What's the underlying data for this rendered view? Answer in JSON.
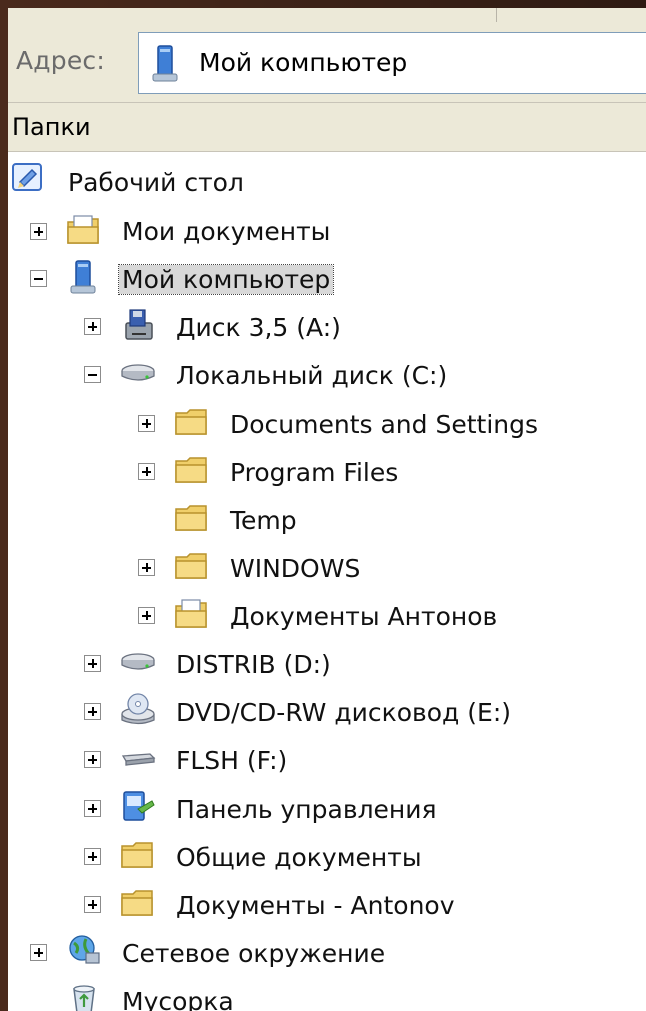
{
  "address": {
    "label": "Адрес:",
    "value": "Мой компьютер",
    "icon": "my-computer-icon"
  },
  "folders_pane": {
    "header": "Папки"
  },
  "tree": [
    {
      "label": "Рабочий стол",
      "icon": "desktop-icon",
      "expanded": true
    },
    {
      "label": "Мои документы",
      "icon": "my-documents-icon",
      "expanded": false
    },
    {
      "label": "Мой компьютер",
      "icon": "my-computer-icon",
      "expanded": true,
      "selected": true
    },
    {
      "label": "Диск 3,5 (A:)",
      "icon": "floppy-drive-icon",
      "expanded": false
    },
    {
      "label": "Локальный диск (C:)",
      "icon": "hard-drive-icon",
      "expanded": true
    },
    {
      "label": "Documents and Settings",
      "icon": "folder-icon",
      "expanded": false
    },
    {
      "label": "Program Files",
      "icon": "folder-icon",
      "expanded": false
    },
    {
      "label": "Temp",
      "icon": "folder-icon"
    },
    {
      "label": "WINDOWS",
      "icon": "folder-icon",
      "expanded": false
    },
    {
      "label": "Документы Антонов",
      "icon": "shared-documents-folder-icon",
      "expanded": false
    },
    {
      "label": "DISTRIB (D:)",
      "icon": "hard-drive-icon",
      "expanded": false
    },
    {
      "label": "DVD/CD-RW дисковод (E:)",
      "icon": "cd-drive-icon",
      "expanded": false
    },
    {
      "label": "FLSH (F:)",
      "icon": "removable-drive-icon",
      "expanded": false
    },
    {
      "label": "Панель управления",
      "icon": "control-panel-icon",
      "expanded": false
    },
    {
      "label": "Общие документы",
      "icon": "folder-icon",
      "expanded": false
    },
    {
      "label": "Документы - Antonov",
      "icon": "folder-icon",
      "expanded": false
    },
    {
      "label": "Сетевое окружение",
      "icon": "network-places-icon",
      "expanded": false
    },
    {
      "label": "Мусорка",
      "icon": "recycle-bin-icon"
    }
  ]
}
